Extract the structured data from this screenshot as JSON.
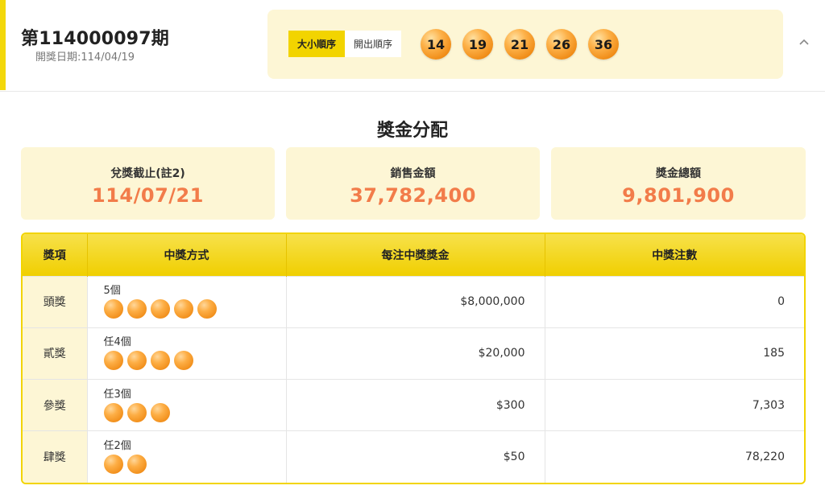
{
  "header": {
    "draw_title": "第114000097期",
    "draw_date": "開獎日期:114/04/19",
    "order_tabs": [
      {
        "label": "大小順序",
        "active": true
      },
      {
        "label": "開出順序",
        "active": false
      }
    ],
    "balls": [
      "14",
      "19",
      "21",
      "26",
      "36"
    ],
    "collapse_icon": "chevron-up-icon"
  },
  "section_title": "獎金分配",
  "summary": [
    {
      "label": "兌獎截止(註2)",
      "value": "114/07/21"
    },
    {
      "label": "銷售金額",
      "value": "37,782,400"
    },
    {
      "label": "獎金總額",
      "value": "9,801,900"
    }
  ],
  "table": {
    "headers": [
      "獎項",
      "中獎方式",
      "每注中獎獎金",
      "中獎注數"
    ],
    "rows": [
      {
        "level": "頭獎",
        "method": "5個",
        "ball_count": 5,
        "prize": "$8,000,000",
        "winners": "0"
      },
      {
        "level": "貳獎",
        "method": "任4個",
        "ball_count": 4,
        "prize": "$20,000",
        "winners": "185"
      },
      {
        "level": "參獎",
        "method": "任3個",
        "ball_count": 3,
        "prize": "$300",
        "winners": "7,303"
      },
      {
        "level": "肆獎",
        "method": "任2個",
        "ball_count": 2,
        "prize": "$50",
        "winners": "78,220"
      }
    ]
  },
  "colors": {
    "accent_yellow": "#f2d400",
    "panel_cream": "#fdf6d5",
    "value_orange": "#f27c4a",
    "ball_orange": "#f08c17"
  }
}
